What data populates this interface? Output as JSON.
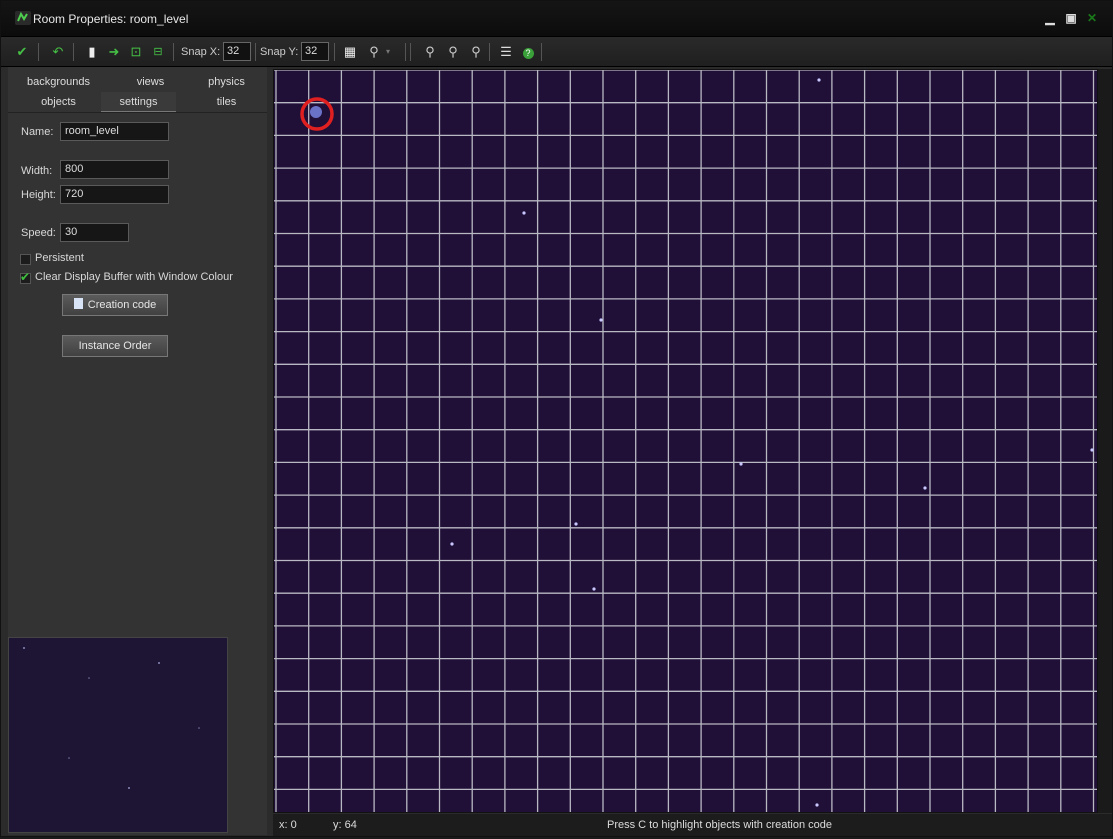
{
  "window": {
    "title": "Room Properties: room_level",
    "controls": [
      "minimize",
      "maximize",
      "close"
    ]
  },
  "toolbar": {
    "icons": [
      "ok-check-icon",
      "undo-icon",
      "clear-icon",
      "shift-icon",
      "lock-all-icon",
      "unlock-all-icon"
    ],
    "snap_x_label": "Snap X:",
    "snap_x_value": "32",
    "snap_y_label": "Snap Y:",
    "snap_y_value": "32",
    "view_icons": [
      "grid-icon",
      "zoom-dropdown-icon"
    ],
    "zoom_icons": [
      "zoom-out-icon",
      "zoom-reset-icon",
      "zoom-in-icon"
    ],
    "extra_icons": [
      "room-settings-icon",
      "help-icon"
    ]
  },
  "tabs": {
    "row1": [
      "backgrounds",
      "views",
      "physics"
    ],
    "row2": [
      "objects",
      "settings",
      "tiles"
    ],
    "active": "settings"
  },
  "settings": {
    "name_label": "Name:",
    "name_value": "room_level",
    "width_label": "Width:",
    "width_value": "800",
    "height_label": "Height:",
    "height_value": "720",
    "speed_label": "Speed:",
    "speed_value": "30",
    "persistent_label": "Persistent",
    "persistent_checked": false,
    "clear_display_label": "Clear Display Buffer with Window Colour",
    "clear_display_checked": true,
    "creation_code_label": "Creation code",
    "instance_order_label": "Instance Order"
  },
  "status": {
    "x_label": "x: 0",
    "y_label": "y: 64",
    "message": "Press C to highlight objects with creation code"
  },
  "colors": {
    "canvas_background": "#200f36",
    "grid_line": "#b9b9c4",
    "highlight_circle": "#e02020",
    "accent_green": "#3a9d3a"
  }
}
